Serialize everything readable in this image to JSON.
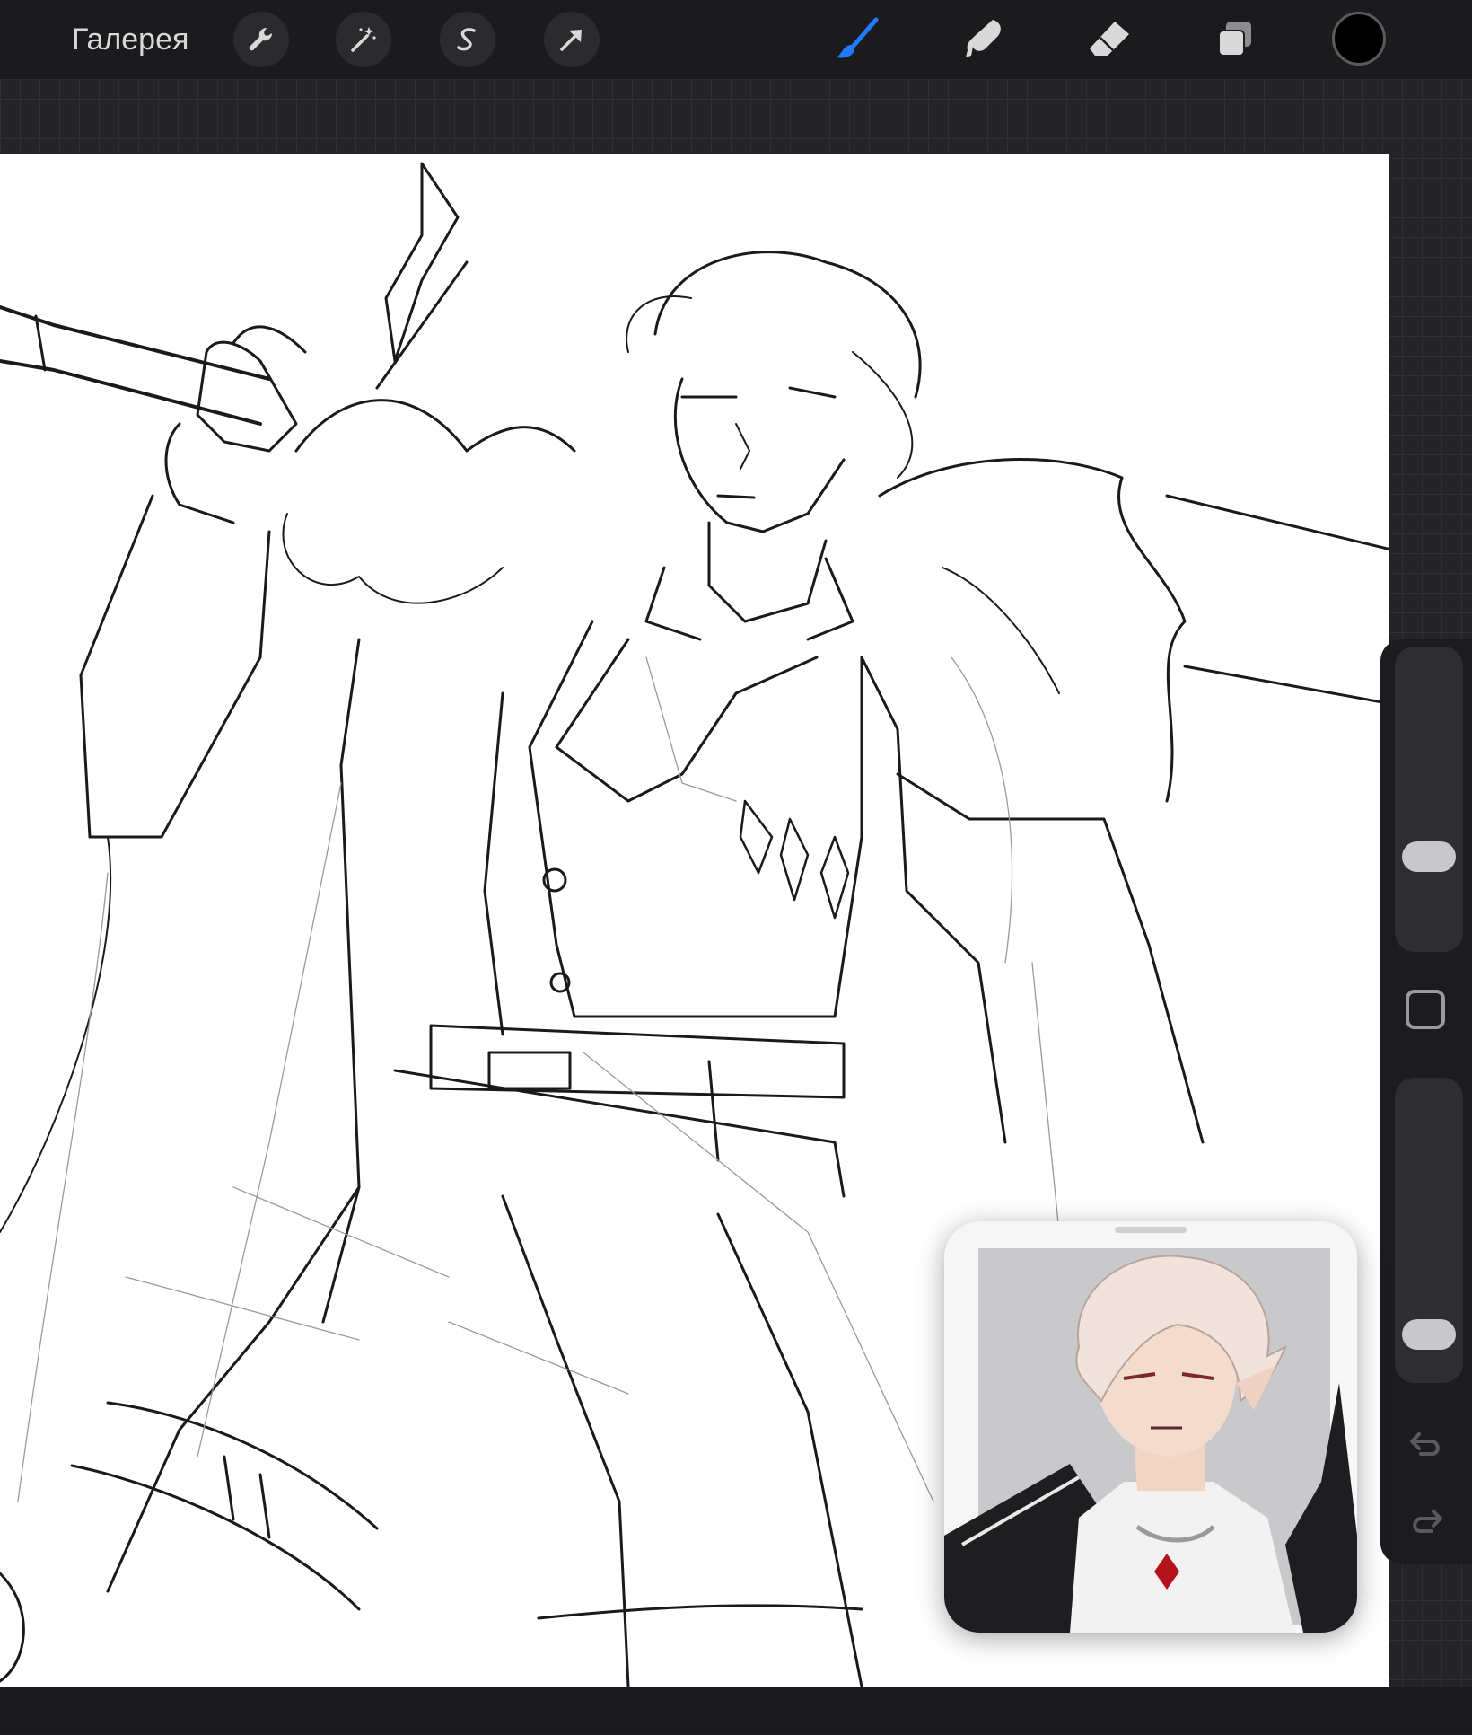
{
  "topbar": {
    "gallery_label": "Галерея",
    "actions": [
      {
        "name": "wrench-icon"
      },
      {
        "name": "magic-wand-icon"
      },
      {
        "name": "selection-s-icon"
      },
      {
        "name": "transform-arrow-icon"
      }
    ],
    "tools": [
      {
        "name": "brush-icon",
        "active": true,
        "color": "#1f7aff"
      },
      {
        "name": "smudge-icon",
        "active": false
      },
      {
        "name": "eraser-icon",
        "active": false
      },
      {
        "name": "layers-icon",
        "active": false
      }
    ],
    "current_color": "#000000"
  },
  "sidebar": {
    "brush_size_level": 0.28,
    "opacity_level": 0.1,
    "modifier_icon": "square-icon",
    "undo_icon": "undo-icon",
    "redo_icon": "redo-icon"
  },
  "canvas": {
    "background": "#ffffff",
    "content": "sketch-drawing"
  },
  "reference": {
    "content": "reference-image"
  }
}
